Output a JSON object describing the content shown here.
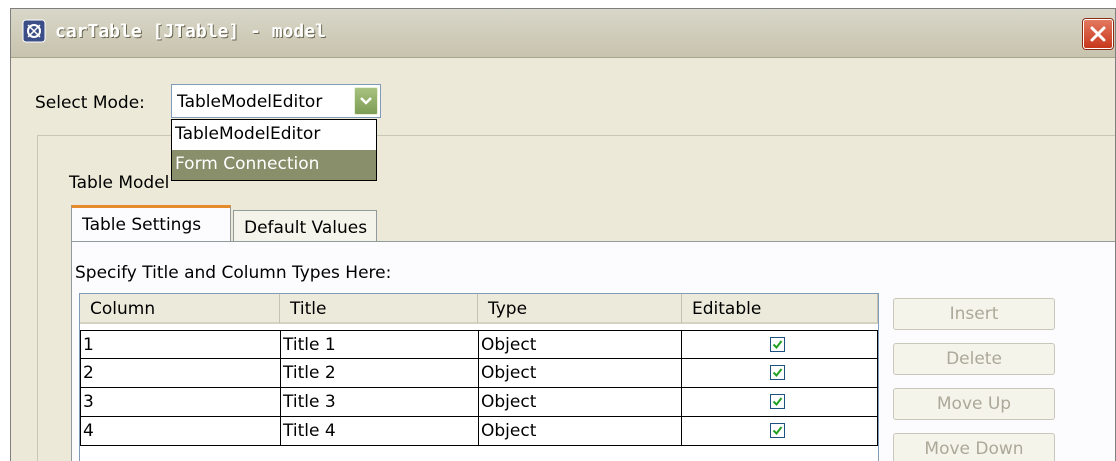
{
  "window": {
    "title": "carTable [JTable] - model"
  },
  "mode": {
    "label": "Select Mode:",
    "selected": "TableModelEditor",
    "options": [
      "TableModelEditor",
      "Form Connection"
    ],
    "highlighted": "Form Connection"
  },
  "panel": {
    "label": "Table Model"
  },
  "tabs": [
    {
      "label": "Table Settings",
      "active": true
    },
    {
      "label": "Default Values",
      "active": false
    }
  ],
  "settings": {
    "instruction": "Specify Title and Column Types Here:"
  },
  "table": {
    "columns": [
      "Column",
      "Title",
      "Type",
      "Editable"
    ],
    "rows": [
      {
        "column": "1",
        "title": "Title 1",
        "type": "Object",
        "editable": true
      },
      {
        "column": "2",
        "title": "Title 2",
        "type": "Object",
        "editable": true
      },
      {
        "column": "3",
        "title": "Title 3",
        "type": "Object",
        "editable": true
      },
      {
        "column": "4",
        "title": "Title 4",
        "type": "Object",
        "editable": true
      }
    ]
  },
  "buttons": {
    "insert": "Insert",
    "delete": "Delete",
    "move_up": "Move Up",
    "move_down": "Move Down"
  },
  "colors": {
    "window_bg": "#ece9d8",
    "selection": "#8a8f6b",
    "close_button": "#c7371b",
    "tab_highlight": "#e68b2c",
    "disabled_text": "#aca899"
  },
  "icons": {
    "app": "app-logo-icon",
    "close": "close-icon",
    "dropdown": "chevron-down-icon",
    "checked": "checkmark-icon"
  }
}
